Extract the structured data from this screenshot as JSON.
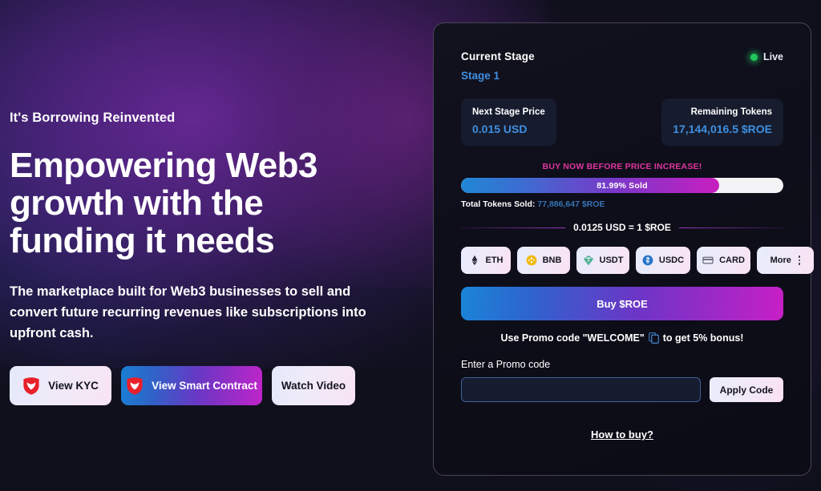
{
  "hero": {
    "eyebrow": "It's Borrowing Reinvented",
    "title": "Empowering Web3 growth with the funding it needs",
    "subtitle": "The marketplace built for Web3 businesses to sell and convert future recurring revenues like subscriptions into upfront cash.",
    "buttons": [
      {
        "label": "View KYC",
        "icon": "shield-heart-icon",
        "style": "light"
      },
      {
        "label": "View Smart Contract",
        "icon": "shield-heart-icon",
        "style": "gradient"
      },
      {
        "label": "Watch Video",
        "icon": "none",
        "style": "light"
      }
    ]
  },
  "sale_card": {
    "current_stage_label": "Current Stage",
    "current_stage_value": "Stage 1",
    "status": {
      "label": "Live",
      "color": "#22c55e"
    },
    "stats": [
      {
        "title": "Next Stage Price",
        "value": "0.015 USD"
      },
      {
        "title": "Remaining Tokens",
        "value": "17,144,016.5 $ROE"
      }
    ],
    "banner": "BUY NOW BEFORE PRICE INCREASE!",
    "progress": {
      "label": "81.99% Sold",
      "percent": 81.99,
      "fill_width_pct": 80
    },
    "tokens_sold": {
      "label": "Total Tokens Sold:",
      "value": "77,886,647 $ROE"
    },
    "rate": "0.0125 USD = 1 $ROE",
    "payment_methods": [
      {
        "id": "pay-eth",
        "label": "ETH",
        "icon": "ethereum-icon",
        "color": "#2b2b3a"
      },
      {
        "id": "pay-bnb",
        "label": "BNB",
        "icon": "bnb-icon",
        "color": "#f0b90b"
      },
      {
        "id": "pay-usdt",
        "label": "USDT",
        "icon": "usdt-icon",
        "color": "#50af95"
      },
      {
        "id": "pay-usdc",
        "label": "USDC",
        "icon": "usdc-icon",
        "color": "#2775ca"
      },
      {
        "id": "pay-card",
        "label": "CARD",
        "icon": "credit-card-icon",
        "color": "#5a5a6a"
      },
      {
        "id": "pay-more",
        "label": "More",
        "icon": "more-vertical-icon",
        "color": "#3a3a4a"
      }
    ],
    "buy_button": "Buy $ROE",
    "promo_hint_before": "Use Promo code \"WELCOME\"",
    "promo_hint_after": "to get 5% bonus!",
    "promo_field_label": "Enter a Promo code",
    "promo_input_value": "",
    "promo_input_placeholder": "",
    "apply_button": "Apply Code",
    "how_to_buy": "How to buy?"
  }
}
